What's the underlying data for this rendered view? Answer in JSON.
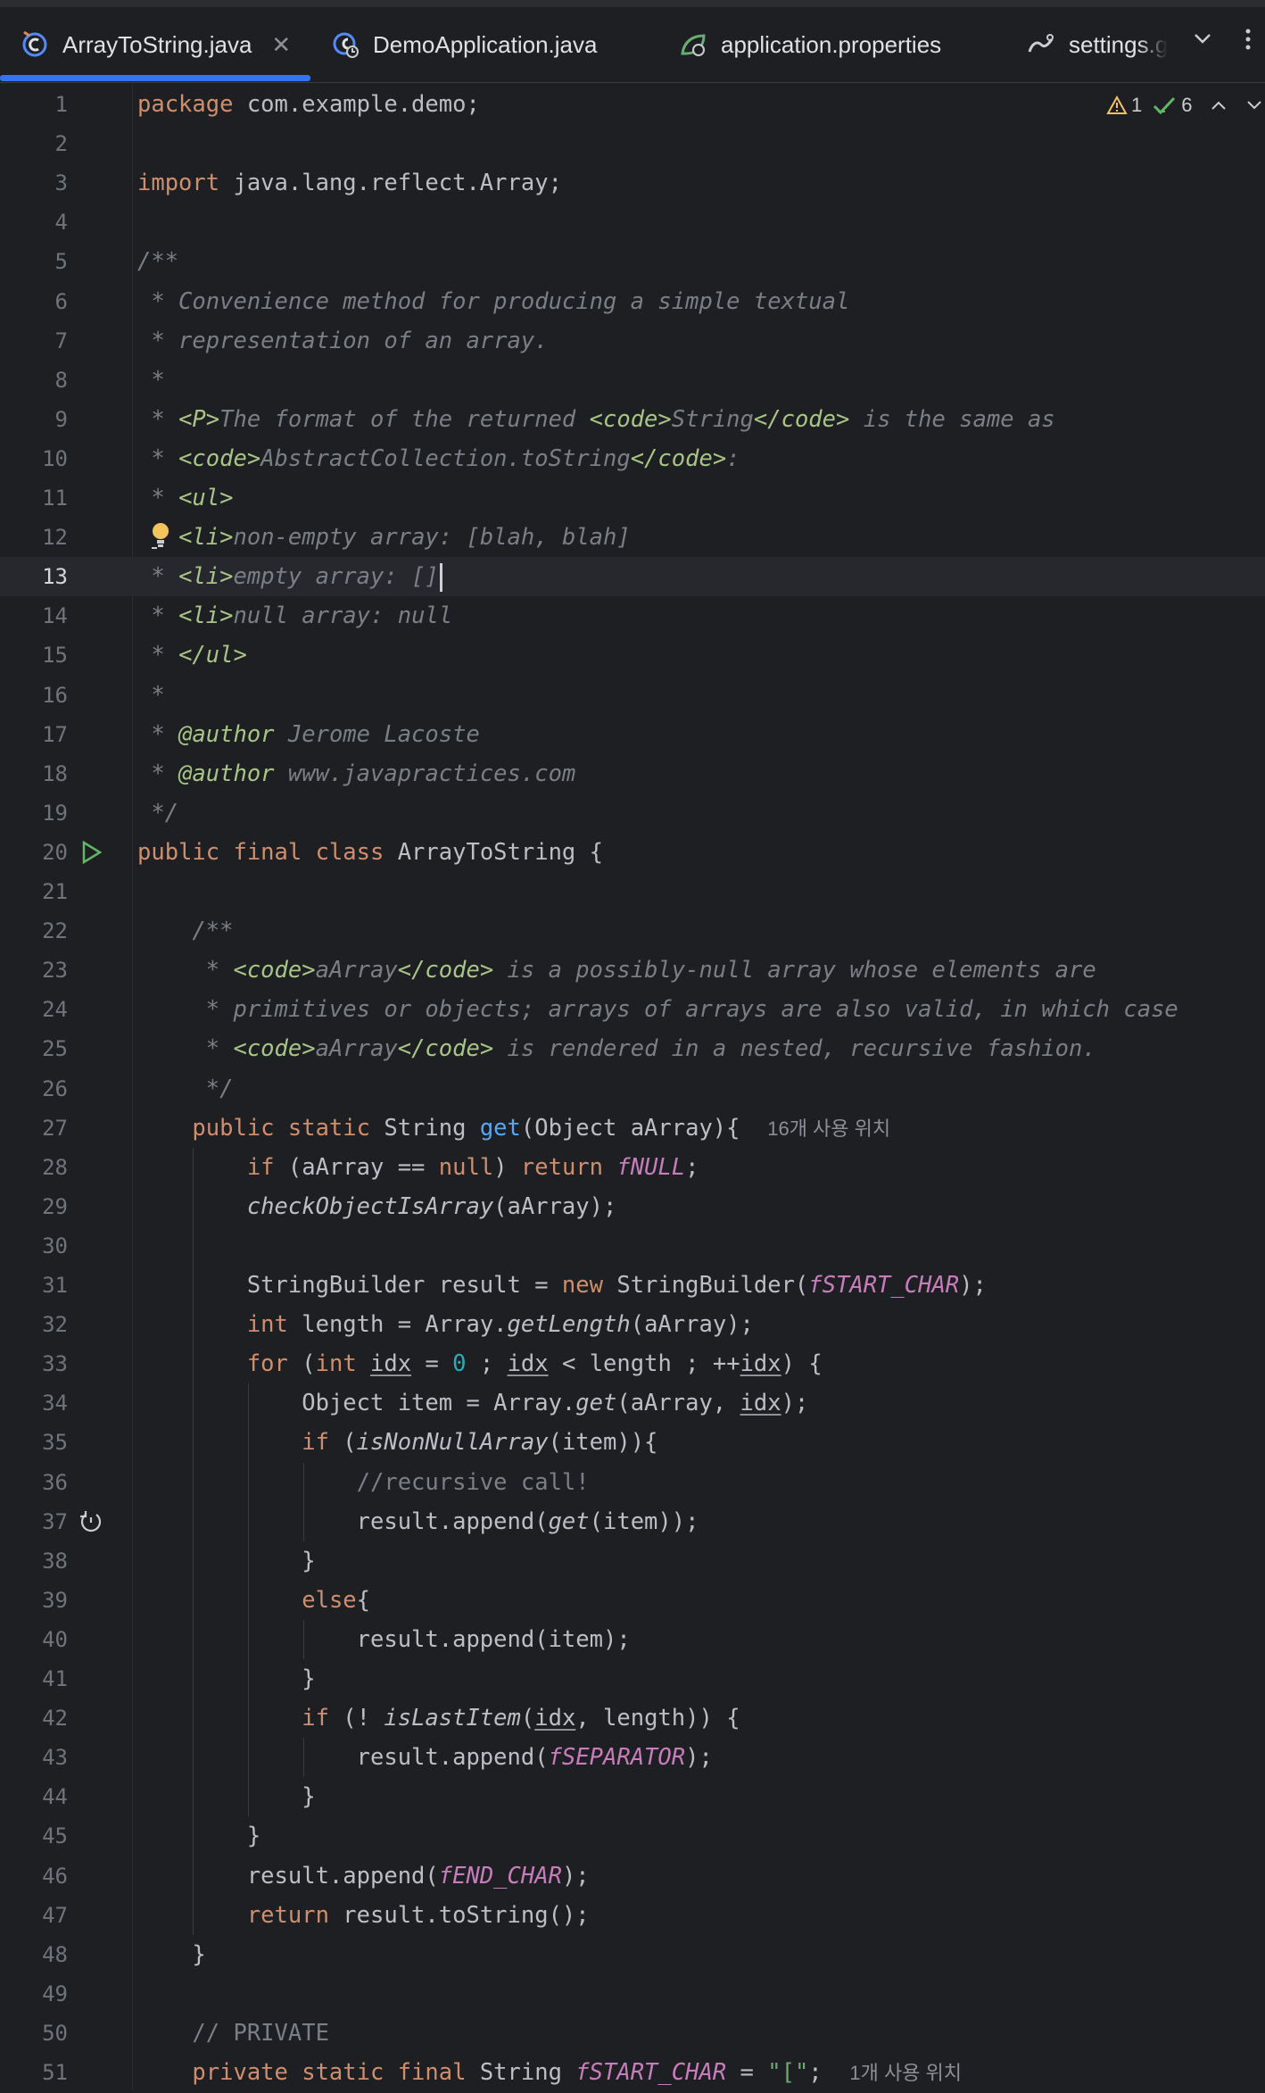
{
  "tabs": [
    {
      "label": "ArrayToString.java",
      "active": true,
      "icon": "java-class-icon"
    },
    {
      "label": "DemoApplication.java",
      "active": false,
      "icon": "java-app-icon"
    },
    {
      "label": "application.properties",
      "active": false,
      "icon": "spring-leaf-icon"
    },
    {
      "label": "settings.g",
      "active": false,
      "icon": "gradle-icon"
    }
  ],
  "inspection": {
    "warnings": "1",
    "ok": "6"
  },
  "hints": {
    "usage_get": "16개 사용 위치",
    "usage_start": "1개 사용 위치"
  },
  "colors": {
    "accent": "#3574f0",
    "keyword": "#cf8e6d",
    "comment": "#7a7e85",
    "doc_tag": "#a8c587",
    "static_field": "#c77dbb",
    "method": "#56a8f5",
    "number": "#2aacb8",
    "string": "#6aab73",
    "background": "#1e1f22"
  },
  "lines": [
    [
      [
        "kw",
        "package "
      ],
      [
        "tx",
        "com.example.demo;"
      ]
    ],
    [],
    [
      [
        "kw",
        "import "
      ],
      [
        "tx",
        "java.lang.reflect.Array;"
      ]
    ],
    [],
    [
      [
        "cm",
        "/**"
      ]
    ],
    [
      [
        "cm",
        " * Convenience method for producing a simple textual"
      ]
    ],
    [
      [
        "cm",
        " * representation of an array."
      ]
    ],
    [
      [
        "cm",
        " *"
      ]
    ],
    [
      [
        "cm",
        " * "
      ],
      [
        "tg",
        "<P>"
      ],
      [
        "cm",
        "The format of the returned "
      ],
      [
        "tg",
        "<code>"
      ],
      [
        "cm",
        "String"
      ],
      [
        "tg",
        "</code>"
      ],
      [
        "cm",
        " is the same as"
      ]
    ],
    [
      [
        "cm",
        " * "
      ],
      [
        "tg",
        "<code>"
      ],
      [
        "cm",
        "AbstractCollection.toString"
      ],
      [
        "tg",
        "</code>"
      ],
      [
        "cm",
        ":"
      ]
    ],
    [
      [
        "cm",
        " * "
      ],
      [
        "tg",
        "<ul>"
      ]
    ],
    [
      [
        "cm",
        " * "
      ],
      [
        "tg",
        "<li>"
      ],
      [
        "cm",
        "non-empty array: [blah, blah]"
      ]
    ],
    [
      [
        "cm",
        " * "
      ],
      [
        "tg",
        "<li>"
      ],
      [
        "cm",
        "empty array: []"
      ]
    ],
    [
      [
        "cm",
        " * "
      ],
      [
        "tg",
        "<li>"
      ],
      [
        "cm",
        "null array: null"
      ]
    ],
    [
      [
        "cm",
        " * "
      ],
      [
        "tg",
        "</ul>"
      ]
    ],
    [
      [
        "cm",
        " *"
      ]
    ],
    [
      [
        "cm",
        " * "
      ],
      [
        "tg",
        "@author"
      ],
      [
        "cm",
        " Jerome Lacoste"
      ]
    ],
    [
      [
        "cm",
        " * "
      ],
      [
        "tg",
        "@author"
      ],
      [
        "cm",
        " www.javapractices.com"
      ]
    ],
    [
      [
        "cm",
        " */"
      ]
    ],
    [
      [
        "kw",
        "public final class "
      ],
      [
        "tx",
        "ArrayToString {"
      ]
    ],
    [],
    [
      [
        "cm",
        "    /**"
      ]
    ],
    [
      [
        "cm",
        "     * "
      ],
      [
        "tg",
        "<code>"
      ],
      [
        "cm",
        "aArray"
      ],
      [
        "tg",
        "</code>"
      ],
      [
        "cm",
        " is a possibly-null array whose elements are"
      ]
    ],
    [
      [
        "cm",
        "     * primitives or objects; arrays of arrays are also valid, in which case"
      ]
    ],
    [
      [
        "cm",
        "     * "
      ],
      [
        "tg",
        "<code>"
      ],
      [
        "cm",
        "aArray"
      ],
      [
        "tg",
        "</code>"
      ],
      [
        "cm",
        " is rendered in a nested, recursive fashion."
      ]
    ],
    [
      [
        "cm",
        "     */"
      ]
    ],
    [
      [
        "kw",
        "    public static "
      ],
      [
        "tx",
        "String "
      ],
      [
        "fn",
        "get"
      ],
      [
        "tx",
        "(Object aArray){  "
      ],
      [
        "hint",
        "16개 사용 위치"
      ]
    ],
    [
      [
        "tx",
        "        "
      ],
      [
        "kw",
        "if "
      ],
      [
        "tx",
        "(aArray == "
      ],
      [
        "kw",
        "null"
      ],
      [
        "tx",
        ") "
      ],
      [
        "kw",
        "return "
      ],
      [
        "ps",
        "fNULL"
      ],
      [
        "tx",
        ";"
      ]
    ],
    [
      [
        "tx",
        "        "
      ],
      [
        "it",
        "checkObjectIsArray"
      ],
      [
        "tx",
        "(aArray);"
      ]
    ],
    [],
    [
      [
        "tx",
        "        StringBuilder result = "
      ],
      [
        "kw",
        "new "
      ],
      [
        "tx",
        "StringBuilder("
      ],
      [
        "ps",
        "fSTART_CHAR"
      ],
      [
        "tx",
        ");"
      ]
    ],
    [
      [
        "tx",
        "        "
      ],
      [
        "kw",
        "int "
      ],
      [
        "tx",
        "length = Array."
      ],
      [
        "it",
        "getLength"
      ],
      [
        "tx",
        "(aArray);"
      ]
    ],
    [
      [
        "tx",
        "        "
      ],
      [
        "kw",
        "for "
      ],
      [
        "tx",
        "("
      ],
      [
        "kw",
        "int "
      ],
      [
        "ul",
        "idx"
      ],
      [
        "tx",
        " = "
      ],
      [
        "nm",
        "0"
      ],
      [
        "tx",
        " ; "
      ],
      [
        "ul",
        "idx"
      ],
      [
        "tx",
        " < length ; ++"
      ],
      [
        "ul",
        "idx"
      ],
      [
        "tx",
        ") {"
      ]
    ],
    [
      [
        "tx",
        "            Object item = Array."
      ],
      [
        "it",
        "get"
      ],
      [
        "tx",
        "(aArray, "
      ],
      [
        "ul",
        "idx"
      ],
      [
        "tx",
        ");"
      ]
    ],
    [
      [
        "tx",
        "            "
      ],
      [
        "kw",
        "if "
      ],
      [
        "tx",
        "("
      ],
      [
        "it",
        "isNonNullArray"
      ],
      [
        "tx",
        "(item)){"
      ]
    ],
    [
      [
        "lc",
        "                //recursive call!"
      ]
    ],
    [
      [
        "tx",
        "                result.append("
      ],
      [
        "it",
        "get"
      ],
      [
        "tx",
        "(item));"
      ]
    ],
    [
      [
        "tx",
        "            }"
      ]
    ],
    [
      [
        "tx",
        "            "
      ],
      [
        "kw",
        "else"
      ],
      [
        "tx",
        "{"
      ]
    ],
    [
      [
        "tx",
        "                result.append(item);"
      ]
    ],
    [
      [
        "tx",
        "            }"
      ]
    ],
    [
      [
        "tx",
        "            "
      ],
      [
        "kw",
        "if "
      ],
      [
        "tx",
        "(! "
      ],
      [
        "it",
        "isLastItem"
      ],
      [
        "tx",
        "("
      ],
      [
        "ul",
        "idx"
      ],
      [
        "tx",
        ", length)) {"
      ]
    ],
    [
      [
        "tx",
        "                result.append("
      ],
      [
        "ps",
        "fSEPARATOR"
      ],
      [
        "tx",
        ");"
      ]
    ],
    [
      [
        "tx",
        "            }"
      ]
    ],
    [
      [
        "tx",
        "        }"
      ]
    ],
    [
      [
        "tx",
        "        result.append("
      ],
      [
        "ps",
        "fEND_CHAR"
      ],
      [
        "tx",
        ");"
      ]
    ],
    [
      [
        "tx",
        "        "
      ],
      [
        "kw",
        "return "
      ],
      [
        "tx",
        "result.toString();"
      ]
    ],
    [
      [
        "tx",
        "    }"
      ]
    ],
    [],
    [
      [
        "lc",
        "    // PRIVATE"
      ]
    ],
    [
      [
        "kw",
        "    private static final "
      ],
      [
        "tx",
        "String "
      ],
      [
        "ps",
        "fSTART_CHAR"
      ],
      [
        "tx",
        " = "
      ],
      [
        "st",
        "\"[\""
      ],
      [
        "tx",
        ";  "
      ],
      [
        "hint",
        "1개 사용 위치"
      ]
    ]
  ]
}
